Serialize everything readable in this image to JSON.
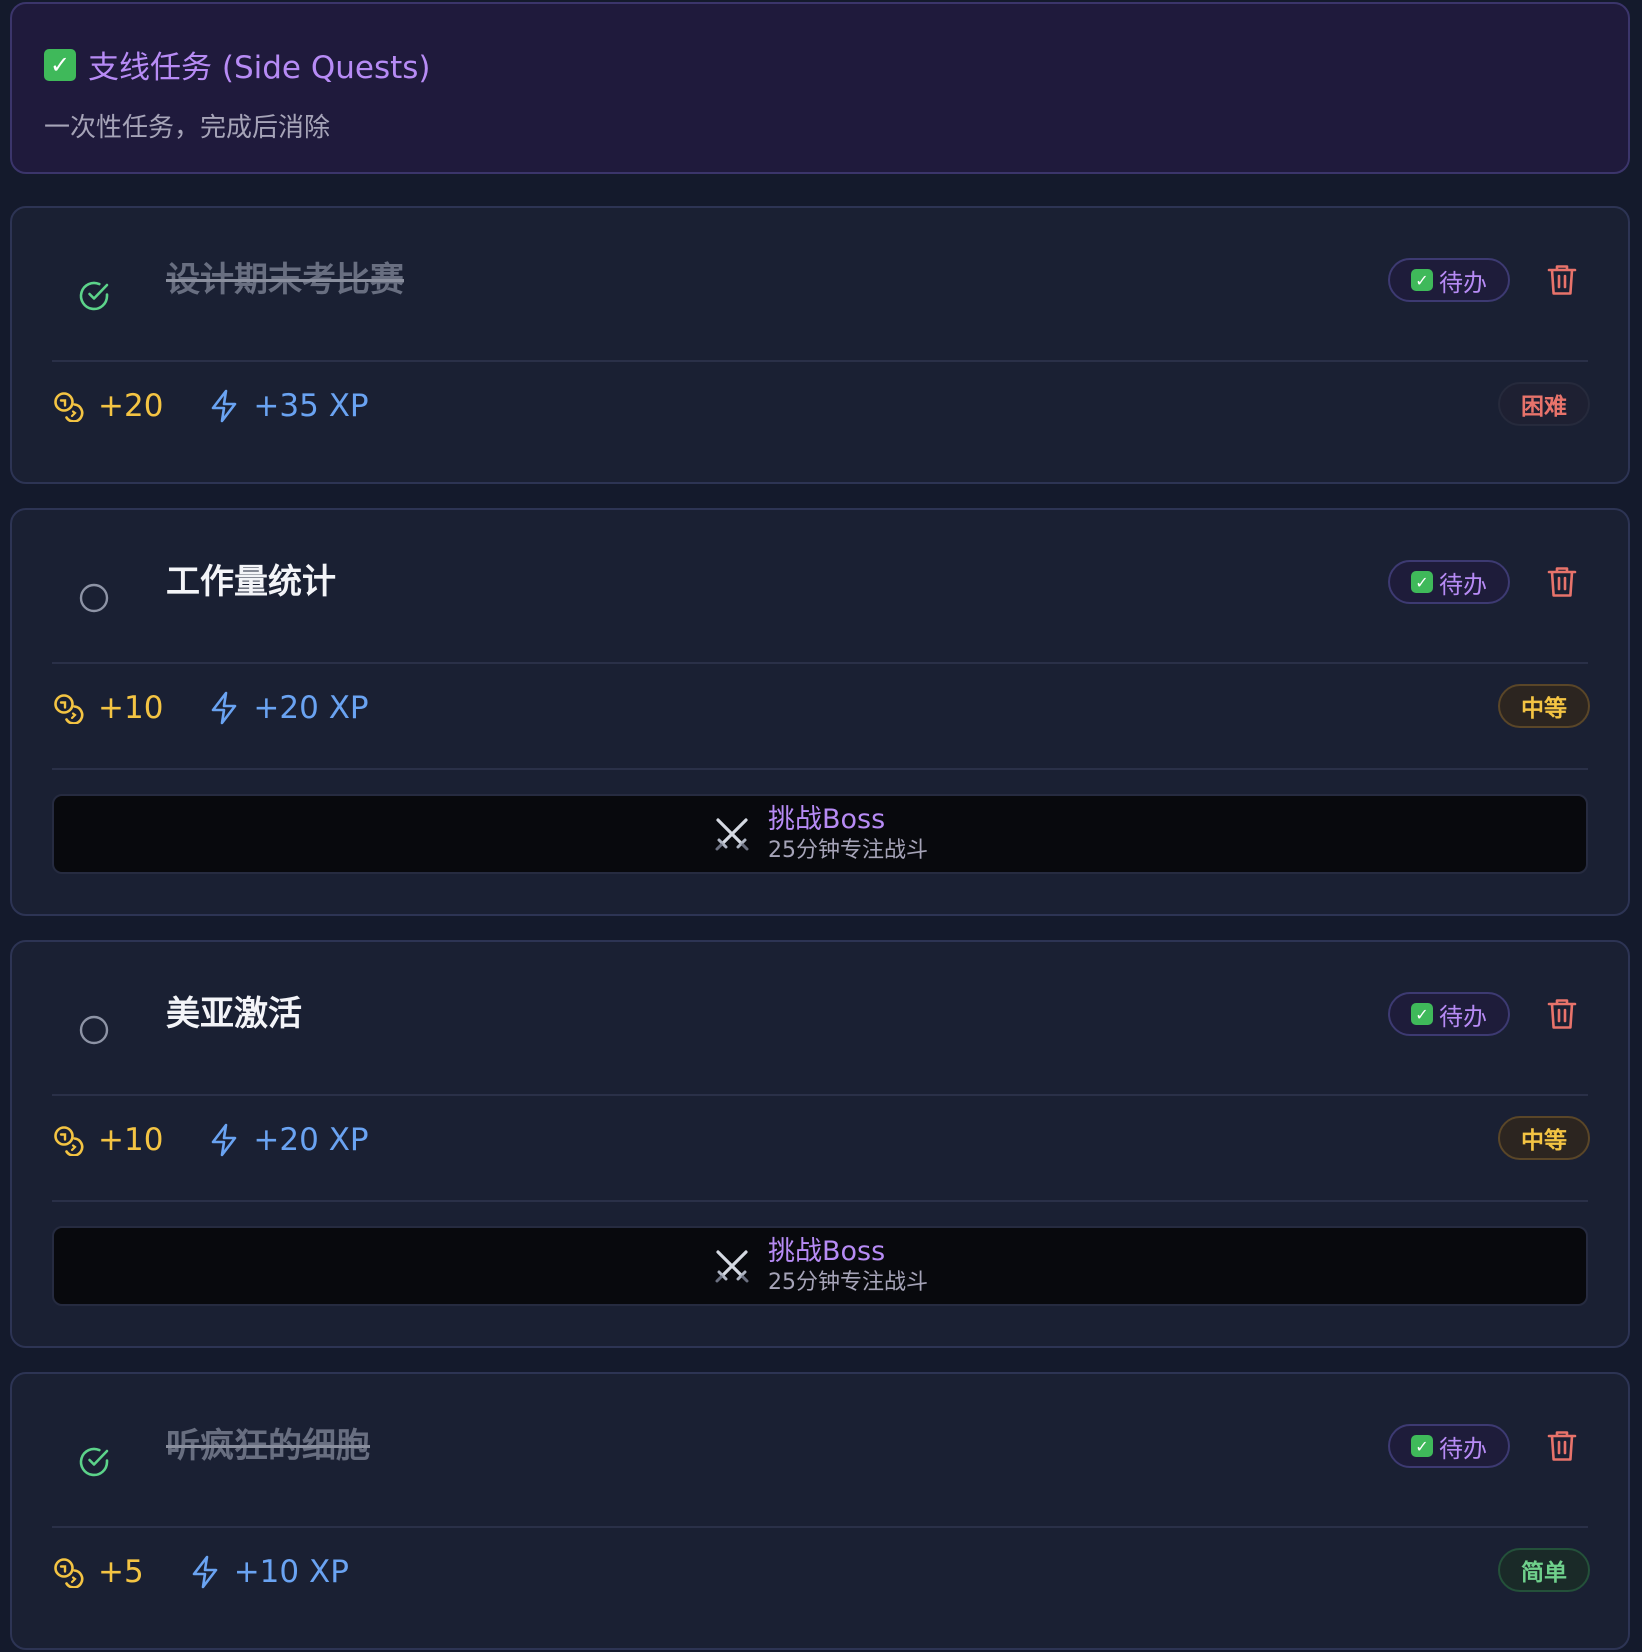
{
  "header": {
    "title": "支线任务 (Side Quests)",
    "subtitle": "一次性任务，完成后消除",
    "icon": "white-check-mark-emoji"
  },
  "colors": {
    "accent_purple": "#b78bf5",
    "coin_gold": "#f4c443",
    "xp_blue": "#6aa3f2",
    "done_green": "#5cd38a",
    "delete_red": "#e8736b",
    "card_bg": "#1a2033",
    "page_bg": "#141a2c"
  },
  "quests": [
    {
      "title": "设计期末考比赛",
      "completed": true,
      "status_label": "待办",
      "coins": "+20",
      "xp": "+35 XP",
      "difficulty": "困难",
      "difficulty_level": "hard",
      "has_boss": false
    },
    {
      "title": "工作量统计",
      "completed": false,
      "status_label": "待办",
      "coins": "+10",
      "xp": "+20 XP",
      "difficulty": "中等",
      "difficulty_level": "medium",
      "has_boss": true,
      "boss": {
        "title": "挑战Boss",
        "subtitle": "25分钟专注战斗",
        "icon": "crossed-swords-icon"
      }
    },
    {
      "title": "美亚激活",
      "completed": false,
      "status_label": "待办",
      "coins": "+10",
      "xp": "+20 XP",
      "difficulty": "中等",
      "difficulty_level": "medium",
      "has_boss": true,
      "boss": {
        "title": "挑战Boss",
        "subtitle": "25分钟专注战斗",
        "icon": "crossed-swords-icon"
      }
    },
    {
      "title": "听疯狂的细胞",
      "completed": true,
      "status_label": "待办",
      "coins": "+5",
      "xp": "+10 XP",
      "difficulty": "简单",
      "difficulty_level": "easy",
      "has_boss": false
    }
  ]
}
